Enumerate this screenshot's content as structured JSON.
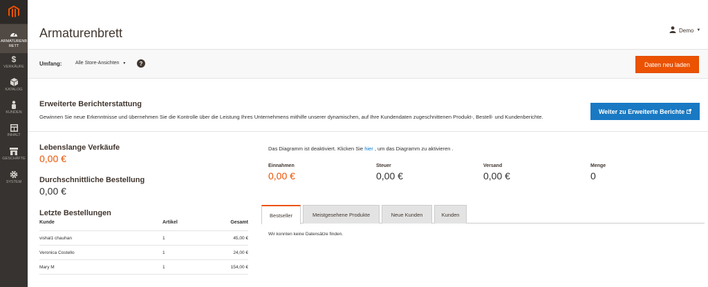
{
  "app": {
    "logo": "magento-logo"
  },
  "sidebar": {
    "items": [
      {
        "label": "ARMATURENBRETT",
        "icon": "dashboard-icon"
      },
      {
        "label": "VERKÄUFE",
        "icon": "dollar-icon"
      },
      {
        "label": "KATALOG",
        "icon": "cube-icon"
      },
      {
        "label": "KUNDEN",
        "icon": "person-icon"
      },
      {
        "label": "INHALT",
        "icon": "layout-icon"
      },
      {
        "label": "GESCHÄFTE",
        "icon": "store-icon"
      },
      {
        "label": "SYSTEM",
        "icon": "gear-icon"
      }
    ]
  },
  "header": {
    "title": "Armaturenbrett",
    "user": "Demo"
  },
  "scope": {
    "label": "Umfang:",
    "selected": "Alle Store-Ansichten",
    "help": "?",
    "reload_label": "Daten neu laden"
  },
  "advanced": {
    "title": "Erweiterte Berichterstattung",
    "description": "Gewinnen Sie neue Erkenntnisse und übernehmen Sie die Kontrolle über die Leistung Ihres Unternehmens mithilfe unserer dynamischen, auf Ihre Kundendaten zugeschnittenen Produkt-, Bestell- und Kundenberichte.",
    "button_label": "Weiter zu Erweiterte Berichte"
  },
  "stats": {
    "lifetime_title": "Lebenslange Verkäufe",
    "lifetime_value": "0,00 €",
    "avg_title": "Durchschnittliche Bestellung",
    "avg_value": "0,00 €"
  },
  "orders": {
    "title": "Letzte Bestellungen",
    "columns": [
      "Kunde",
      "Artikel",
      "Gesamt"
    ],
    "rows": [
      {
        "customer": "vishal1 chauhan",
        "items": "1",
        "total": "45,00 €"
      },
      {
        "customer": "Veronica Costello",
        "items": "1",
        "total": "24,00 €"
      },
      {
        "customer": "Mary M",
        "items": "1",
        "total": "154,00 €"
      }
    ]
  },
  "diagram": {
    "msg_before": "Das Diagramm ist deaktiviert. Klicken Sie ",
    "link": "hier",
    "msg_after": " , um das Diagramm zu aktivieren ."
  },
  "totals": [
    {
      "label": "Einnahmen",
      "value": "0,00 €"
    },
    {
      "label": "Steuer",
      "value": "0,00 €"
    },
    {
      "label": "Versand",
      "value": "0,00 €"
    },
    {
      "label": "Menge",
      "value": "0"
    }
  ],
  "tabs": [
    {
      "label": "Bestseller",
      "active": true
    },
    {
      "label": "Meistgesehene Produkte",
      "active": false
    },
    {
      "label": "Neue Kunden",
      "active": false
    },
    {
      "label": "Kunden",
      "active": false
    }
  ],
  "no_data": "Wir konnten keine Datensätze finden.",
  "colors": {
    "accent": "#eb5202",
    "link": "#007bdb",
    "button_blue": "#1979c3",
    "sidebar": "#373330"
  }
}
